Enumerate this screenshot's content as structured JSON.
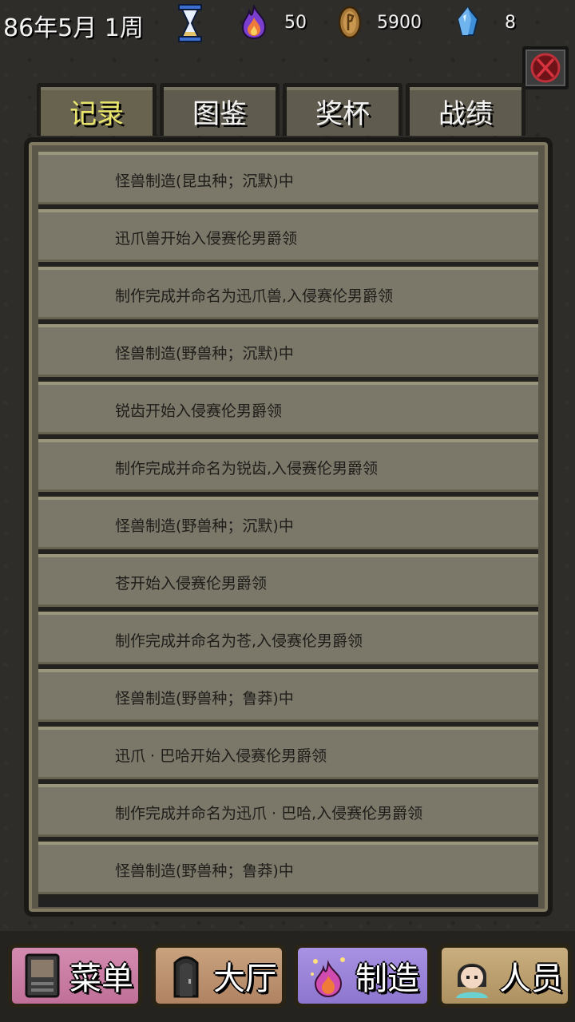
{
  "status": {
    "date": "86年5月 1周",
    "fire_value": "50",
    "coin_value": "5900",
    "crystal_value": "8"
  },
  "tabs": [
    {
      "label": "记录",
      "active": true
    },
    {
      "label": "图鉴",
      "active": false
    },
    {
      "label": "奖杯",
      "active": false
    },
    {
      "label": "战绩",
      "active": false
    }
  ],
  "records": [
    "怪兽制造(昆虫种；沉默)中",
    "迅爪兽开始入侵赛伦男爵领",
    "制作完成并命名为迅爪兽,入侵赛伦男爵领",
    "怪兽制造(野兽种；沉默)中",
    "锐齿开始入侵赛伦男爵领",
    "制作完成并命名为锐齿,入侵赛伦男爵领",
    "怪兽制造(野兽种；沉默)中",
    "苍开始入侵赛伦男爵领",
    "制作完成并命名为苍,入侵赛伦男爵领",
    "怪兽制造(野兽种；鲁莽)中",
    "迅爪 · 巴哈开始入侵赛伦男爵领",
    "制作完成并命名为迅爪 · 巴哈,入侵赛伦男爵领",
    "怪兽制造(野兽种；鲁莽)中"
  ],
  "nav": {
    "menu": "菜单",
    "hall": "大厅",
    "make": "制造",
    "staff": "人员"
  },
  "colors": {
    "active_tab": "#e9e46a",
    "row_bg": "#7b786a",
    "menu_btn": "#c07098",
    "hall_btn": "#b08362",
    "make_btn": "#8d76cf",
    "staff_btn": "#ae9160"
  }
}
